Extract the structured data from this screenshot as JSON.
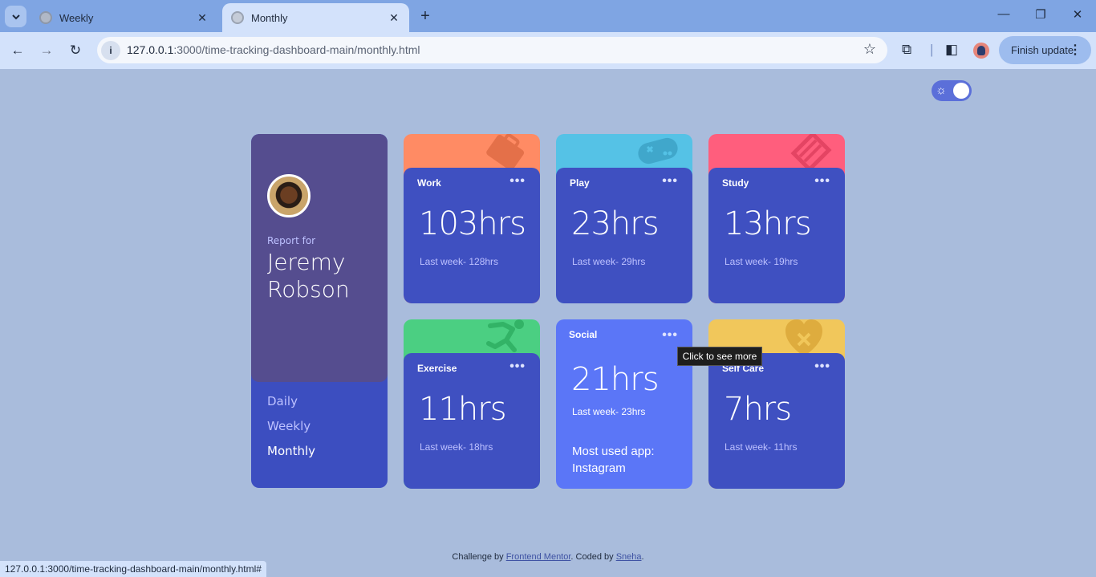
{
  "browser": {
    "tabs": [
      {
        "title": "Weekly",
        "active": false
      },
      {
        "title": "Monthly",
        "active": true
      }
    ],
    "url_host": "127.0.0.1",
    "url_rest": ":3000/time-tracking-dashboard-main/monthly.html",
    "finish_update_label": "Finish update",
    "status_url": "127.0.0.1:3000/time-tracking-dashboard-main/monthly.html#"
  },
  "theme_toggle": {
    "state": "light"
  },
  "profile": {
    "report_for": "Report for",
    "name": "Jeremy Robson",
    "periods": [
      "Daily",
      "Weekly",
      "Monthly"
    ],
    "active_period": "Monthly"
  },
  "cards": [
    {
      "title": "Work",
      "hours": "103hrs",
      "last": "Last week- 128hrs",
      "color": "#ff8b64",
      "icon": "briefcase-icon"
    },
    {
      "title": "Play",
      "hours": "23hrs",
      "last": "Last week- 29hrs",
      "color": "#55c2e6",
      "icon": "gamepad-icon"
    },
    {
      "title": "Study",
      "hours": "13hrs",
      "last": "Last week- 19hrs",
      "color": "#ff5e7d",
      "icon": "book-icon"
    },
    {
      "title": "Exercise",
      "hours": "11hrs",
      "last": "Last week- 18hrs",
      "color": "#4bcf82",
      "icon": "running-icon"
    },
    {
      "title": "Social",
      "hours": "21hrs",
      "last": "Last week- 23hrs",
      "color": "#5b76f7",
      "most_used": "Most used app: Instagram"
    },
    {
      "title": "Self Care",
      "hours": "7hrs",
      "last": "Last week- 11hrs",
      "color": "#f1c75b",
      "icon": "heart-icon"
    }
  ],
  "tooltip": "Click to see more",
  "footer": {
    "prefix": "Challenge by ",
    "link1": "Frontend Mentor",
    "middle": ". Coded by ",
    "link2": "Sneha",
    "suffix": "."
  }
}
